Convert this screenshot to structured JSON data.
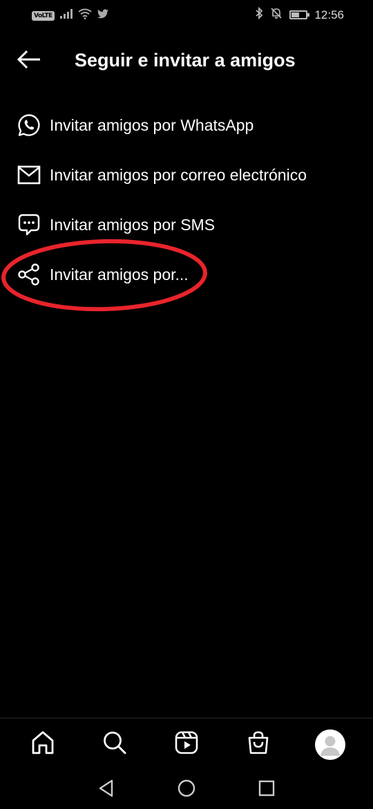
{
  "status_bar": {
    "network_badge": "VoLTE",
    "time": "12:56",
    "battery_level": 0.5,
    "icons": [
      "signal-icon",
      "wifi-icon",
      "twitter-icon",
      "bluetooth-icon",
      "mute-bell-icon",
      "battery-icon"
    ]
  },
  "header": {
    "title": "Seguir e invitar a amigos",
    "back_icon": "arrow-left-icon"
  },
  "menu": {
    "items": [
      {
        "label": "Invitar amigos por WhatsApp",
        "icon": "whatsapp-icon"
      },
      {
        "label": "Invitar amigos por correo electrónico",
        "icon": "mail-icon"
      },
      {
        "label": "Invitar amigos por SMS",
        "icon": "chat-bubble-icon"
      },
      {
        "label": "Invitar amigos por...",
        "icon": "share-icon"
      }
    ]
  },
  "annotation": {
    "type": "ellipse",
    "color": "#e8242b",
    "target": "menu.items.3"
  },
  "bottom_nav": {
    "items": [
      "home-icon",
      "search-icon",
      "reels-icon",
      "shop-icon",
      "profile-avatar"
    ]
  },
  "system_nav": {
    "items": [
      "back-triangle-icon",
      "home-circle-icon",
      "recents-square-icon"
    ]
  }
}
